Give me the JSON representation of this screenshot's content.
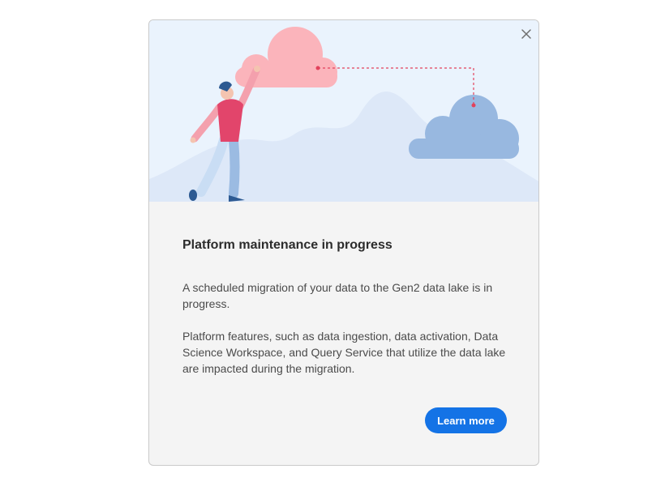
{
  "dialog": {
    "title": "Platform maintenance in progress",
    "paragraphs": [
      "A scheduled migration of your data to the Gen2 data lake is in progress.",
      "Platform features, such as data ingestion, data activation, Data Science Workspace, and Query Service that utilize the data lake are impacted during the migration."
    ],
    "learn_more_label": "Learn more",
    "close_icon": "close-icon"
  },
  "colors": {
    "accent": "#1473e6",
    "illustration_background": "#eaf3fd",
    "pink_cloud": "#fbb4bb",
    "blue_cloud": "#97b7e0",
    "mountains": "#dce8f8",
    "connector": "#e2425c",
    "person_shirt": "#e2456b"
  }
}
